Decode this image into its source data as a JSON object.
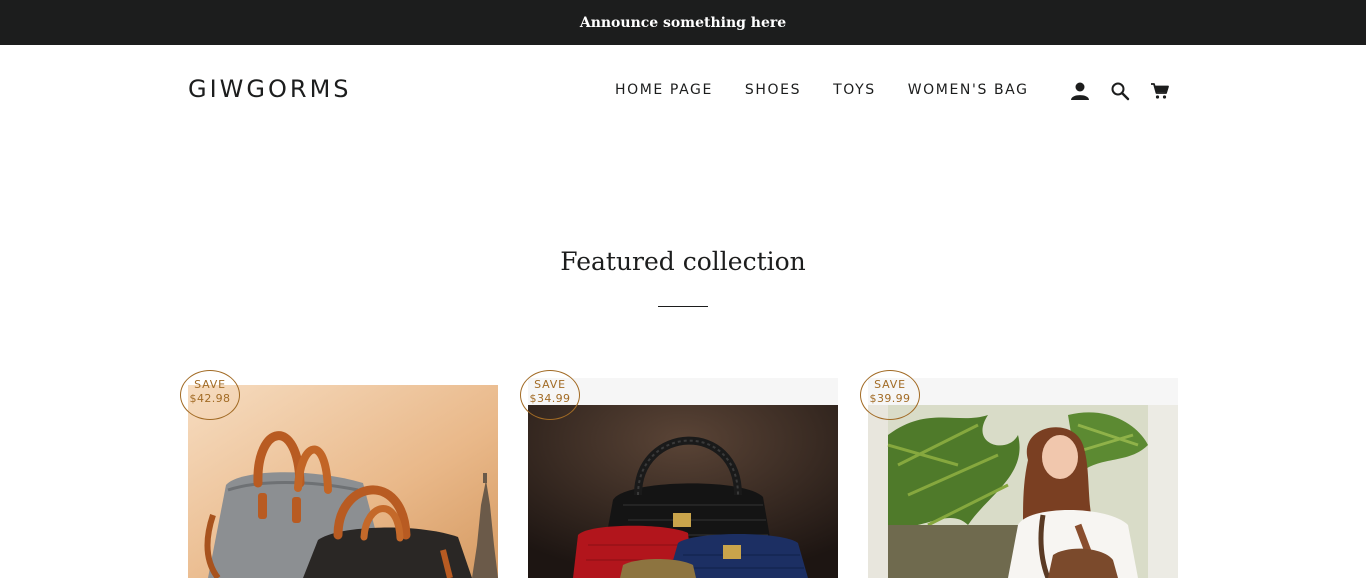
{
  "announcement": {
    "text": "Announce something here"
  },
  "header": {
    "logo": "GIWGORMS",
    "nav": [
      {
        "label": "HOME PAGE"
      },
      {
        "label": "SHOES"
      },
      {
        "label": "TOYS"
      },
      {
        "label": "WOMEN'S BAG"
      }
    ],
    "icons": [
      "account-icon",
      "search-icon",
      "cart-icon"
    ]
  },
  "featured": {
    "title": "Featured collection",
    "products": [
      {
        "save_label": "SAVE",
        "save_amount": "$42.98"
      },
      {
        "save_label": "SAVE",
        "save_amount": "$34.99"
      },
      {
        "save_label": "SAVE",
        "save_amount": "$39.99"
      }
    ]
  },
  "colors": {
    "announcement_bg": "#1c1d1d",
    "text": "#1c1d1d",
    "badge": "#a26b25"
  }
}
